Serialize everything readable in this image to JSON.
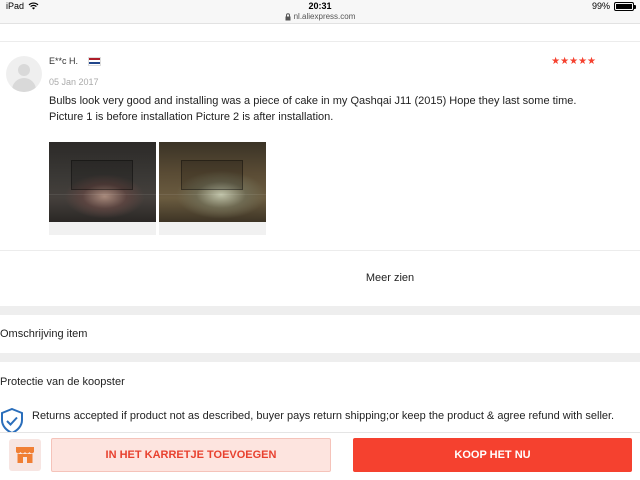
{
  "status_bar": {
    "device": "iPad",
    "time": "20:31",
    "url": "nl.aliexpress.com",
    "battery": "99%",
    "battery_level": 0.99
  },
  "review": {
    "reviewer": "E**c H.",
    "country_flag": "netherlands-flag",
    "rating": 5,
    "stars": "★★★★★",
    "date": "05 Jan 2017",
    "text_line1": "Bulbs look very good and installing was a piece of cake in my Qashqai J11 (2015) Hope they last some time.",
    "text_line2": "Picture 1 is before installation Picture 2 is after installation.",
    "photos": [
      "review-photo-1",
      "review-photo-2"
    ]
  },
  "more": {
    "label": "Meer zien"
  },
  "sections": {
    "description": "Omschrijving item",
    "protection_title": "Protectie van de koopster",
    "returns_text": "Returns accepted if product not as described, buyer pays return shipping;or keep the product & agree refund with seller."
  },
  "bottom_bar": {
    "store_icon": "store-icon",
    "add_to_cart": "IN HET KARRETJE TOEVOEGEN",
    "buy_now": "KOOP HET NU"
  },
  "colors": {
    "accent": "#f5412f",
    "cart_bg": "#fde4df",
    "divider": "#eeeeee"
  }
}
